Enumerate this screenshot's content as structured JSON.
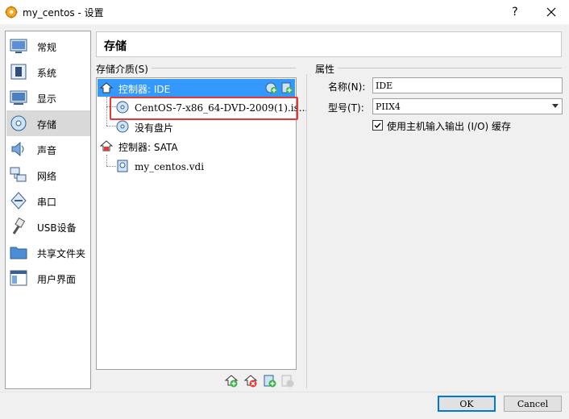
{
  "window": {
    "title": "my_centos - 设置",
    "help": "?",
    "colors": {
      "accent": "#3399ff",
      "highlight": "#e53935"
    }
  },
  "sidebar": {
    "items": [
      {
        "label": "常规",
        "icon": "general-icon"
      },
      {
        "label": "系统",
        "icon": "system-icon"
      },
      {
        "label": "显示",
        "icon": "display-icon"
      },
      {
        "label": "存储",
        "icon": "storage-icon",
        "selected": true
      },
      {
        "label": "声音",
        "icon": "audio-icon"
      },
      {
        "label": "网络",
        "icon": "network-icon"
      },
      {
        "label": "串口",
        "icon": "serial-port-icon"
      },
      {
        "label": "USB设备",
        "icon": "usb-icon"
      },
      {
        "label": "共享文件夹",
        "icon": "shared-folder-icon"
      },
      {
        "label": "用户界面",
        "icon": "user-interface-icon"
      }
    ]
  },
  "header": {
    "title": "存储"
  },
  "storage": {
    "group_label": "存储介质(S)",
    "controllers": [
      {
        "label": "控制器: IDE",
        "devices": [
          {
            "label": "CentOS-7-x86_64-DVD-2009(1).is...",
            "icon": "optical-disc-icon"
          },
          {
            "label": "没有盘片",
            "icon": "optical-disc-icon"
          }
        ]
      },
      {
        "label": "控制器: SATA",
        "devices": [
          {
            "label": "my_centos.vdi",
            "icon": "hard-disk-icon"
          }
        ]
      }
    ]
  },
  "properties": {
    "group_label": "属性",
    "name_label": "名称(N):",
    "name_value": "IDE",
    "type_label": "型号(T):",
    "type_value": "PIIX4",
    "io_cache_label": "使用主机输入输出 (I/O) 缓存",
    "io_cache_checked": true
  },
  "buttons": {
    "ok": "OK",
    "cancel": "Cancel"
  }
}
